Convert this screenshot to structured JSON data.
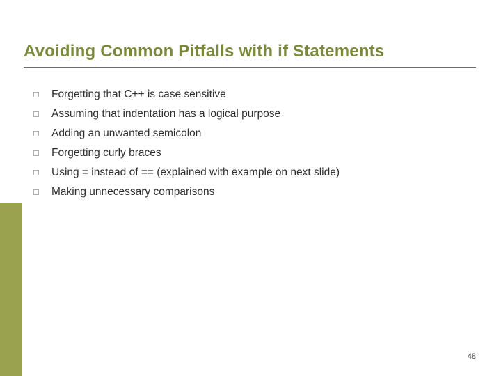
{
  "title": "Avoiding Common Pitfalls with if Statements",
  "bullets": [
    "Forgetting that C++ is case sensitive",
    "Assuming that indentation has a logical purpose",
    "Adding an unwanted semicolon",
    "Forgetting curly braces",
    "Using = instead of == (explained with example on next slide)",
    "Making unnecessary comparisons"
  ],
  "page_number": "48"
}
